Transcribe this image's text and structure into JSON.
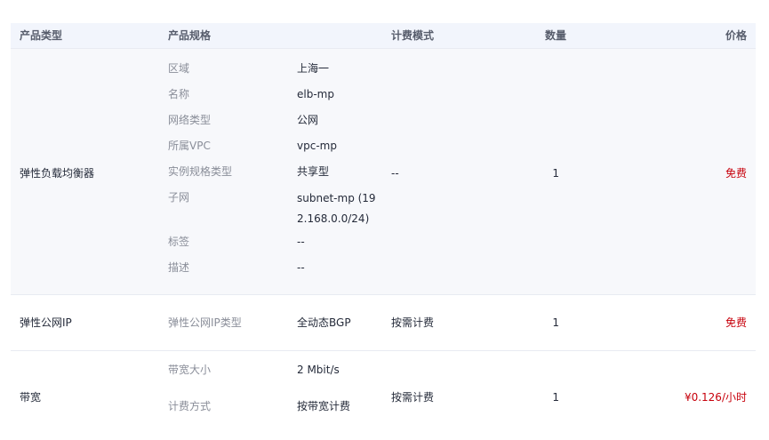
{
  "headers": {
    "type": "产品类型",
    "spec": "产品规格",
    "mode": "计费模式",
    "qty": "数量",
    "price": "价格"
  },
  "rows": [
    {
      "type": "弹性负载均衡器",
      "specs": [
        {
          "k": "区域",
          "v": "上海一"
        },
        {
          "k": "名称",
          "v": "elb-mp"
        },
        {
          "k": "网络类型",
          "v": "公网"
        },
        {
          "k": "所属VPC",
          "v": "vpc-mp"
        },
        {
          "k": "实例规格类型",
          "v": "共享型"
        },
        {
          "k": "子网",
          "v": "subnet-mp (192.168.0.0/24)"
        },
        {
          "k": "标签",
          "v": "--"
        },
        {
          "k": "描述",
          "v": "--"
        }
      ],
      "mode": "--",
      "qty": "1",
      "price": "免费"
    },
    {
      "type": "弹性公网IP",
      "specs": [
        {
          "k": "弹性公网IP类型",
          "v": "全动态BGP"
        }
      ],
      "mode": "按需计费",
      "qty": "1",
      "price": "免费"
    },
    {
      "type": "带宽",
      "specs": [
        {
          "k": "带宽大小",
          "v": "2 Mbit/s"
        },
        {
          "k": "计费方式",
          "v": "按带宽计费"
        }
      ],
      "mode": "按需计费",
      "qty": "1",
      "price": "¥0.126/小时"
    }
  ],
  "colors": {
    "header_bg": "#f2f5fc",
    "row_highlight": "#f7f8fb",
    "price_red": "#c7000b",
    "label_gray": "#8a8e99"
  }
}
